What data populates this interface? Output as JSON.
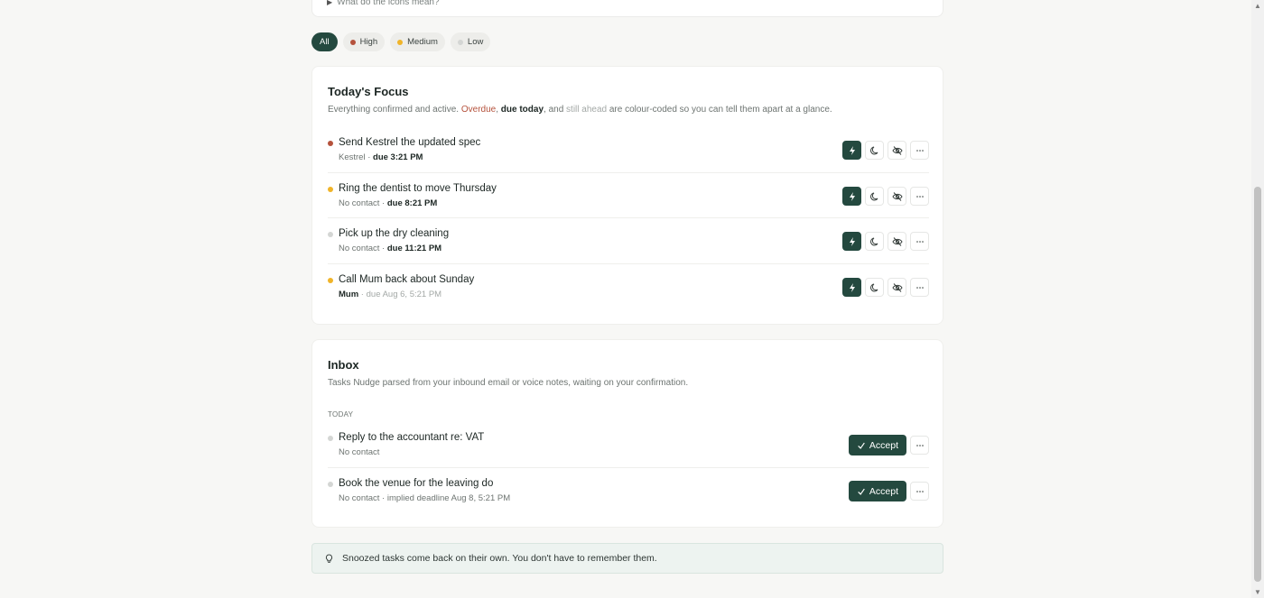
{
  "top_card": {
    "disclosure_label": "What do the icons mean?"
  },
  "filters": [
    {
      "label": "All",
      "active": true
    },
    {
      "label": "High",
      "priority": "high"
    },
    {
      "label": "Medium",
      "priority": "medium"
    },
    {
      "label": "Low",
      "priority": "low"
    }
  ],
  "focus": {
    "title": "Today's Focus",
    "desc_a": "Everything confirmed and active. ",
    "desc_overdue": "Overdue",
    "desc_b": ", ",
    "desc_duetoday": "due today",
    "desc_c": ", and ",
    "desc_ahead": "still ahead",
    "desc_d": " are colour-coded so you can tell them apart at a glance.",
    "tasks": [
      {
        "title": "Send Kestrel the updated spec",
        "contact": "Kestrel",
        "sep": " · ",
        "due": "due 3:21 PM",
        "priority": "high"
      },
      {
        "title": "Ring the dentist to move Thursday",
        "contact": "No contact",
        "sep": " · ",
        "due": "due 8:21 PM",
        "priority": "medium"
      },
      {
        "title": "Pick up the dry cleaning",
        "contact": "No contact",
        "sep": " · ",
        "due": "due 11:21 PM",
        "priority": "low"
      },
      {
        "title": "Call Mum back about Sunday",
        "contact": "Mum",
        "sep": " · ",
        "due": "due Aug 6, 5:21 PM",
        "priority": "medium"
      }
    ]
  },
  "inbox": {
    "title": "Inbox",
    "desc": "Tasks Nudge parsed from your inbound email or voice notes, waiting on your confirmation.",
    "section_label": "TODAY",
    "accept_label": "Accept",
    "tasks": [
      {
        "title": "Reply to the accountant re: VAT",
        "meta": "No contact"
      },
      {
        "title": "Book the venue for the leaving do",
        "meta": "No contact · implied deadline Aug 8, 5:21 PM"
      }
    ]
  },
  "tip": {
    "text": "Snoozed tasks come back on their own. You don't have to remember them."
  },
  "colors": {
    "accent": "#24493f",
    "high": "#b5523c",
    "medium": "#f0b429",
    "low": "#d4d6d4"
  }
}
